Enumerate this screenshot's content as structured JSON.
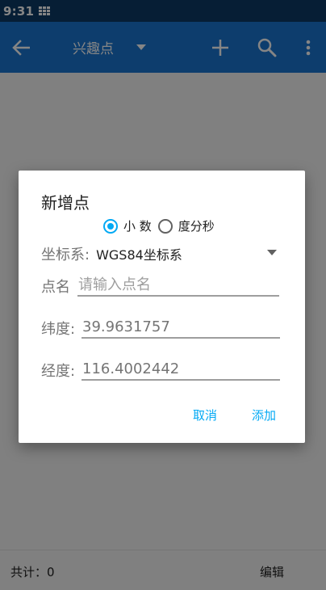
{
  "status_bar": {
    "time": "9:31",
    "notification_icon": "grid-icon"
  },
  "app_bar": {
    "title": "兴趣点",
    "icons": [
      "back-arrow-icon",
      "dropdown-caret-icon",
      "plus-icon",
      "search-icon",
      "more-vert-icon"
    ],
    "background": "#1976d2"
  },
  "bottom_bar": {
    "total_label": "共计：0",
    "edit_label": "编辑"
  },
  "dialog": {
    "title": "新增点",
    "radio_options": [
      {
        "label": "小 数",
        "selected": true
      },
      {
        "label": "度分秒",
        "selected": false
      }
    ],
    "coord_system": {
      "label": "坐标系:",
      "value": "WGS84坐标系"
    },
    "point_name": {
      "label": "点名",
      "placeholder": "请输入点名",
      "value": ""
    },
    "latitude": {
      "label": "纬度:",
      "value": "39.9631757"
    },
    "longitude": {
      "label": "经度:",
      "value": "116.4002442"
    },
    "buttons": {
      "cancel": "取消",
      "add": "添加"
    },
    "accent": "#03a9f4"
  }
}
